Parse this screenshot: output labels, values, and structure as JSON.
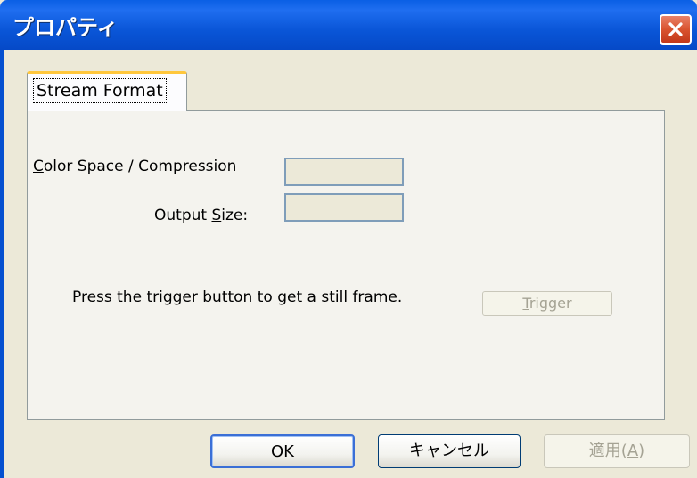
{
  "window": {
    "title": "プロパティ",
    "close_label": "×"
  },
  "tabs": [
    {
      "label": "Stream Format",
      "selected": true
    }
  ],
  "stream_format": {
    "color_space_label_mnemonic": "C",
    "color_space_label_rest": "olor Space / Compression",
    "color_space_value": "",
    "output_size_label_pre": "Output ",
    "output_size_label_mnemonic": "S",
    "output_size_label_post": "ize:",
    "output_size_value": "",
    "trigger_instruction": "Press the trigger button to get a still frame.",
    "trigger_button_pre": "",
    "trigger_button_mnemonic": "T",
    "trigger_button_post": "rigger",
    "trigger_enabled": false
  },
  "buttons": {
    "ok_label": "OK",
    "cancel_label": "キャンセル",
    "apply_label_pre": "適用(",
    "apply_label_mnemonic": "A",
    "apply_label_post": ")",
    "apply_enabled": false
  },
  "colors": {
    "titlebar": "#0a56d8",
    "dialog_face": "#ece9d8",
    "tab_highlight": "#ffc73c",
    "disabled_text": "#a5a394",
    "close_button": "#d9532f"
  }
}
